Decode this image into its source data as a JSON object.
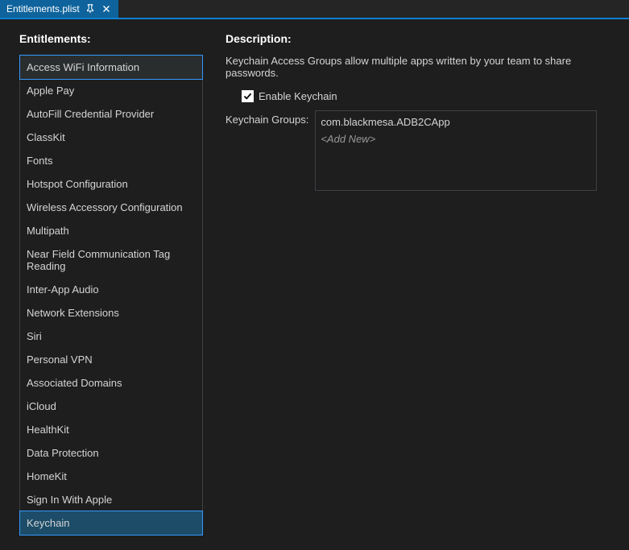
{
  "tab": {
    "title": "Entitlements.plist"
  },
  "left": {
    "heading": "Entitlements:",
    "items": [
      "Access WiFi Information",
      "Apple Pay",
      "AutoFill Credential Provider",
      "ClassKit",
      "Fonts",
      "Hotspot Configuration",
      "Wireless Accessory Configuration",
      "Multipath",
      "Near Field Communication Tag Reading",
      "Inter-App Audio",
      "Network Extensions",
      "Siri",
      "Personal VPN",
      "Associated Domains",
      "iCloud",
      "HealthKit",
      "Data Protection",
      "HomeKit",
      "Sign In With Apple",
      "Keychain"
    ]
  },
  "right": {
    "heading": "Description:",
    "description": "Keychain Access Groups allow multiple apps written by your team to share passwords.",
    "checkbox_label": "Enable Keychain",
    "groups_label": "Keychain Groups:",
    "groups": [
      "com.blackmesa.ADB2CApp"
    ],
    "add_new_label": "<Add New>"
  }
}
